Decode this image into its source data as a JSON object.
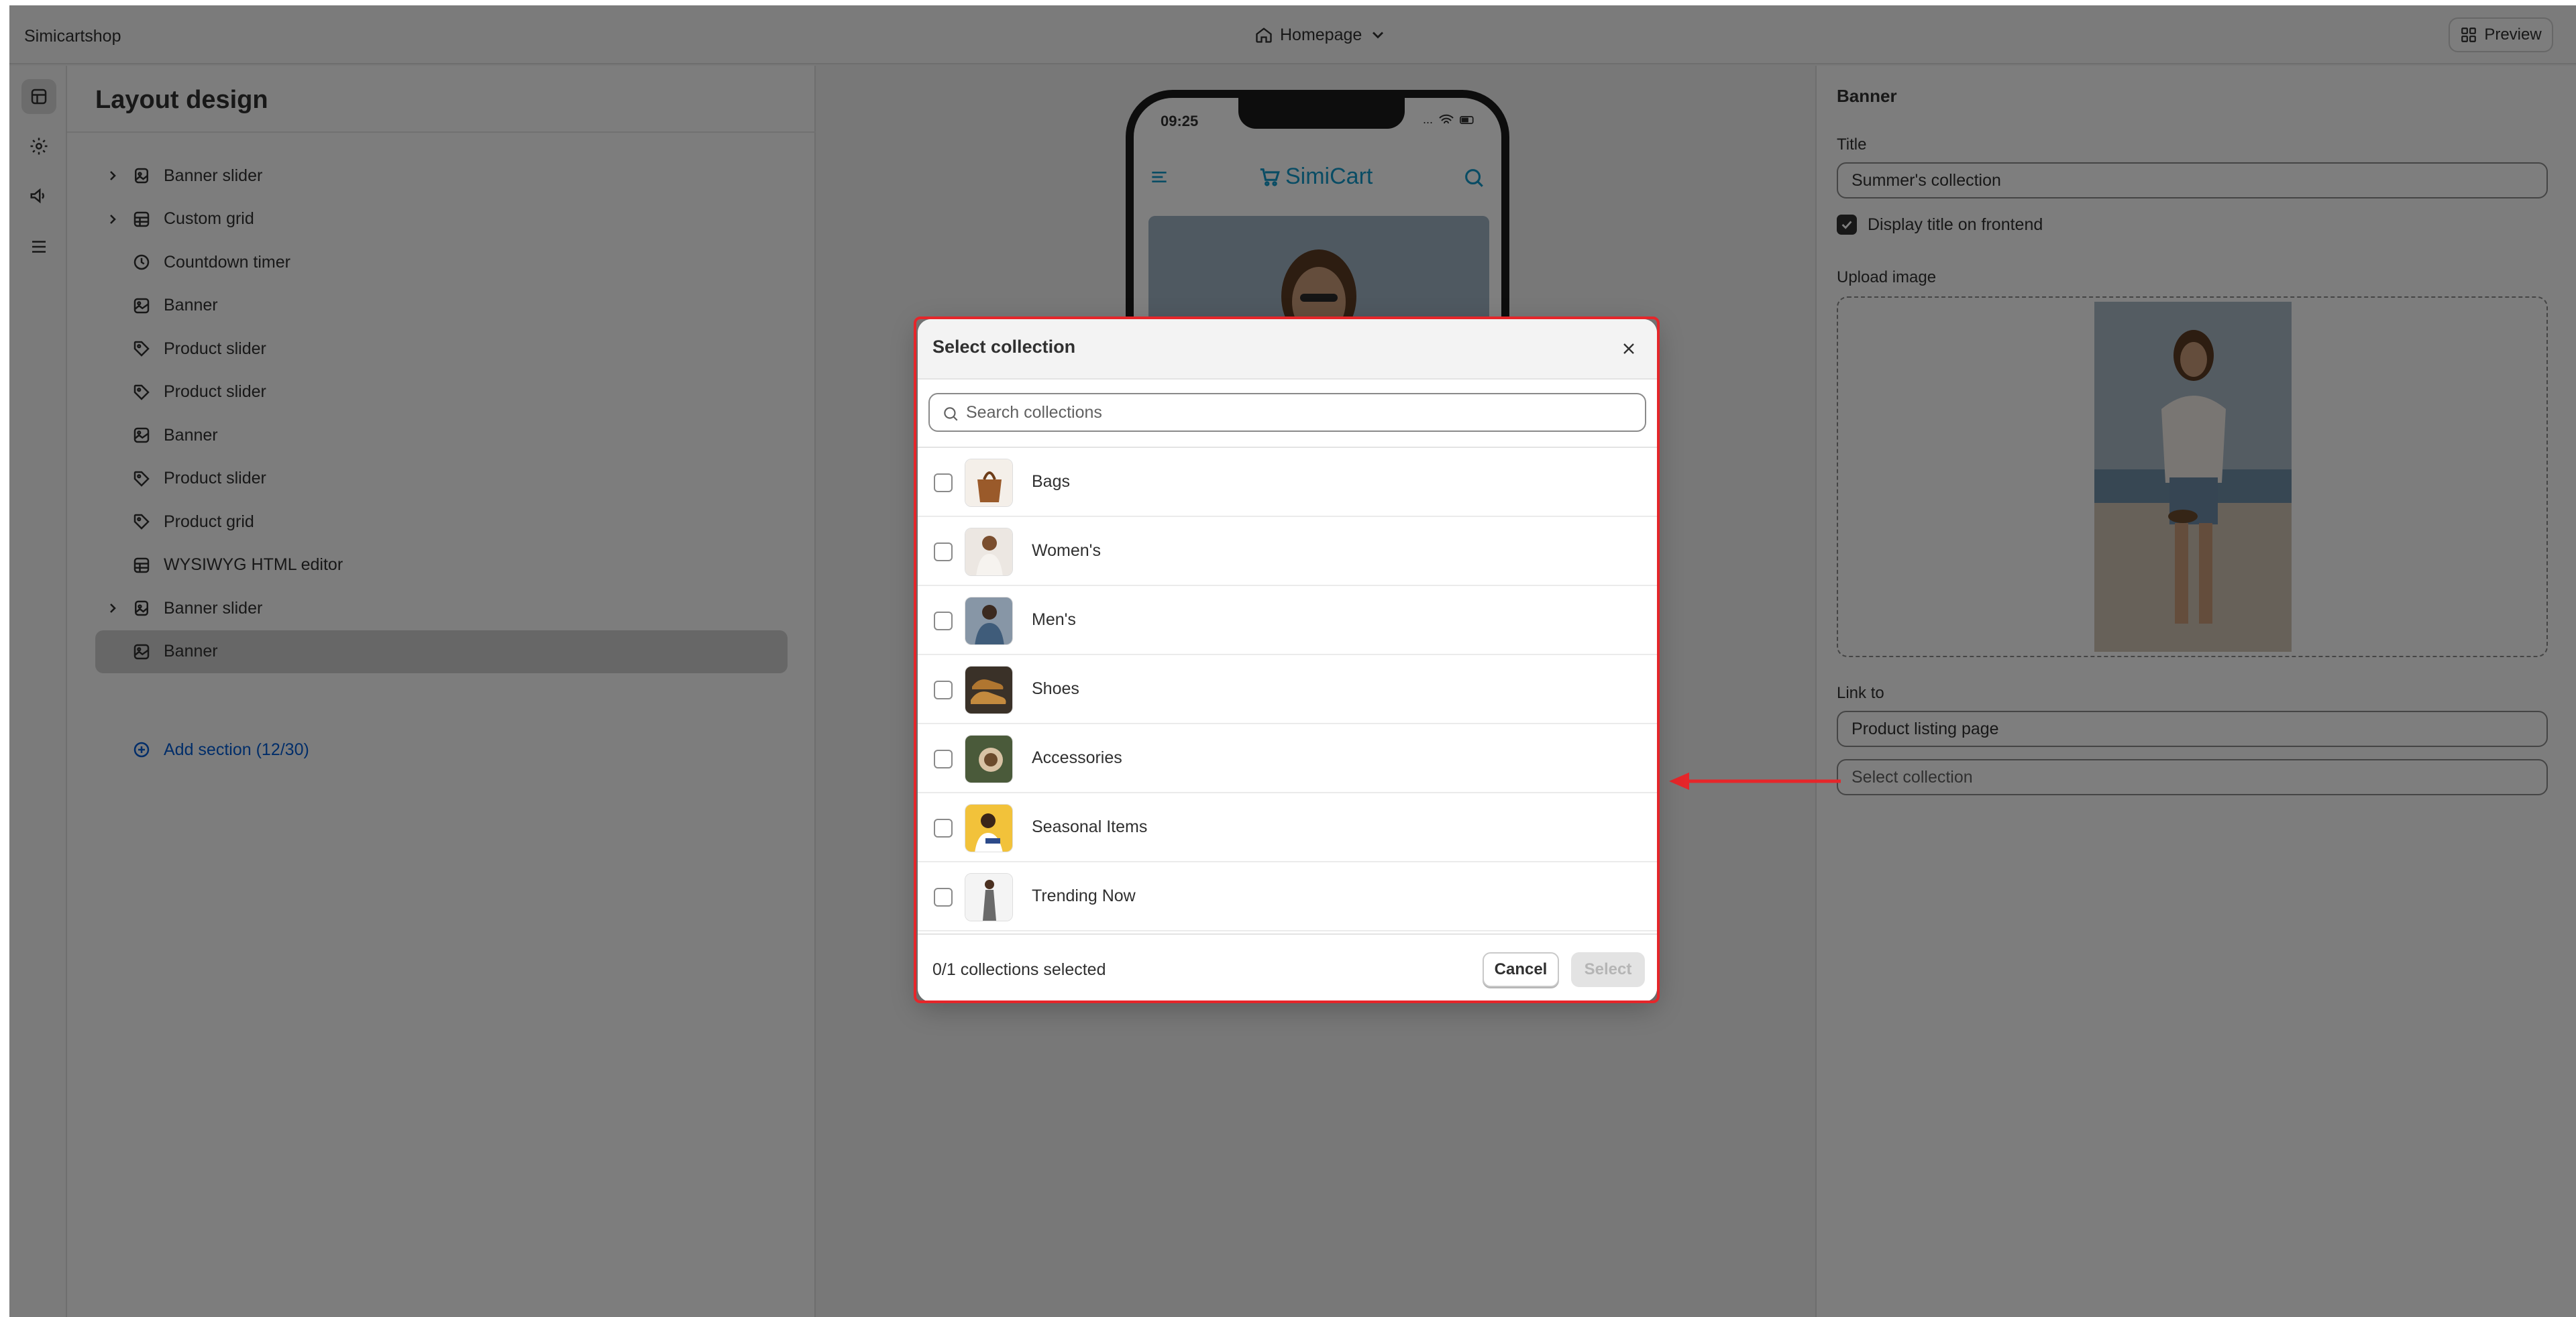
{
  "topbar": {
    "shop_name": "Simicartshop",
    "page_selector": "Homepage",
    "preview_label": "Preview"
  },
  "left_panel": {
    "title": "Layout design",
    "sections": [
      {
        "label": "Banner slider",
        "icon": "slider-icon",
        "expandable": true
      },
      {
        "label": "Custom grid",
        "icon": "grid-icon",
        "expandable": true
      },
      {
        "label": "Countdown timer",
        "icon": "clock-icon",
        "expandable": false
      },
      {
        "label": "Banner",
        "icon": "image-icon",
        "expandable": false
      },
      {
        "label": "Product slider",
        "icon": "tag-icon",
        "expandable": false
      },
      {
        "label": "Product slider",
        "icon": "tag-icon",
        "expandable": false
      },
      {
        "label": "Banner",
        "icon": "image-icon",
        "expandable": false
      },
      {
        "label": "Product slider",
        "icon": "tag-icon",
        "expandable": false
      },
      {
        "label": "Product grid",
        "icon": "tag-icon",
        "expandable": false
      },
      {
        "label": "WYSIWYG HTML editor",
        "icon": "grid-icon",
        "expandable": false
      },
      {
        "label": "Banner slider",
        "icon": "slider-icon",
        "expandable": true
      },
      {
        "label": "Banner",
        "icon": "image-icon",
        "expandable": false,
        "selected": true
      }
    ],
    "add_section_label": "Add section (12/30)"
  },
  "preview": {
    "time": "09:25",
    "status_dots": "...",
    "logo_text": "SimiCart"
  },
  "right_panel": {
    "title": "Banner",
    "title_label": "Title",
    "title_value": "Summer's collection",
    "display_title_label": "Display title on frontend",
    "display_title_checked": true,
    "upload_label": "Upload image",
    "link_label": "Link to",
    "link_value": "Product listing page",
    "collection_placeholder": "Select collection"
  },
  "modal": {
    "title": "Select collection",
    "search_placeholder": "Search collections",
    "collections": [
      {
        "name": "Bags"
      },
      {
        "name": "Women's"
      },
      {
        "name": "Men's"
      },
      {
        "name": "Shoes"
      },
      {
        "name": "Accessories"
      },
      {
        "name": "Seasonal Items"
      },
      {
        "name": "Trending Now"
      }
    ],
    "selected_count": "0/1 collections selected",
    "cancel_label": "Cancel",
    "select_label": "Select"
  },
  "colors": {
    "accent_link": "#005bd3",
    "highlight": "#e5262a",
    "logo": "#1398c9"
  }
}
